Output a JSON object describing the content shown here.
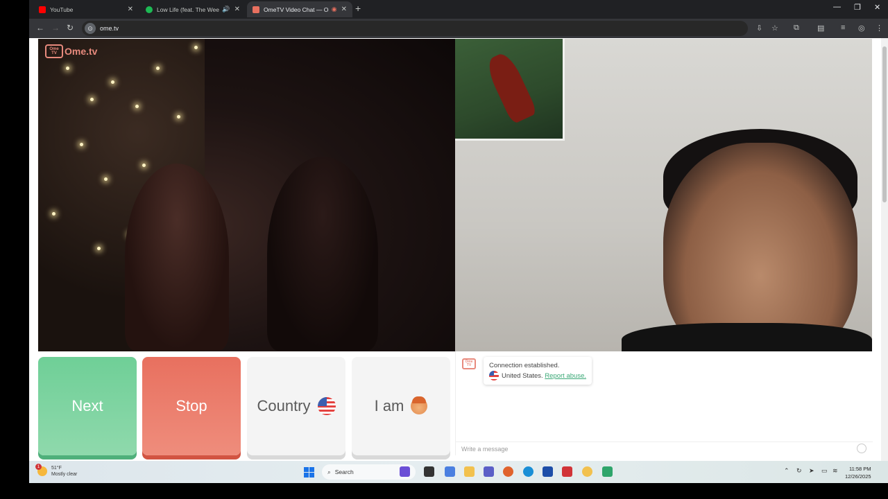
{
  "browser": {
    "tabs": [
      {
        "title": "YouTube",
        "favicon_color": "#ff0000",
        "active": false
      },
      {
        "title": "Low Life (feat. The Weeknd)",
        "favicon_color": "#1db954",
        "active": false
      },
      {
        "title": "OmeTV Video Chat — Ome",
        "favicon_color": "#e8705f",
        "active": true
      }
    ],
    "url": "ome.tv"
  },
  "page": {
    "logo_text": "Ome.tv",
    "logo_box": "Ome TV",
    "buttons": {
      "next": "Next",
      "stop": "Stop",
      "country": "Country",
      "i_am": "I am"
    },
    "chat": {
      "status": "Connection established.",
      "country": "United States.",
      "report": "Report abuse.",
      "placeholder": "Write a message"
    }
  },
  "taskbar": {
    "weather_temp": "51°F",
    "weather_desc": "Mostly clear",
    "weather_badge": "1",
    "search": "Search",
    "time": "11:58 PM",
    "date": "12/26/2025"
  },
  "colors": {
    "next": "#6fcf97",
    "stop": "#e8705f",
    "accent": "#e88a7d"
  }
}
